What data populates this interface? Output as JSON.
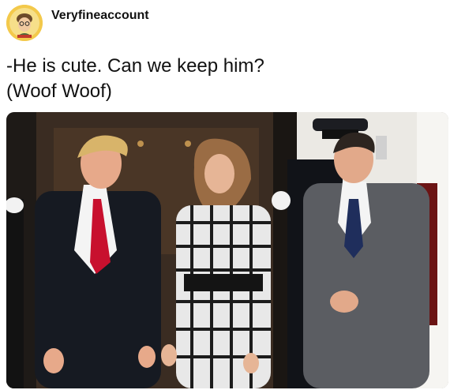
{
  "post": {
    "username": "Veryfineaccount",
    "caption_line1": "-He is cute. Can we keep him?",
    "caption_line2": "(Woof Woof)"
  },
  "avatar": {
    "icon": "profile-avatar-icon",
    "color": "#f3c94b"
  },
  "photo": {
    "icon": "group-photo"
  }
}
